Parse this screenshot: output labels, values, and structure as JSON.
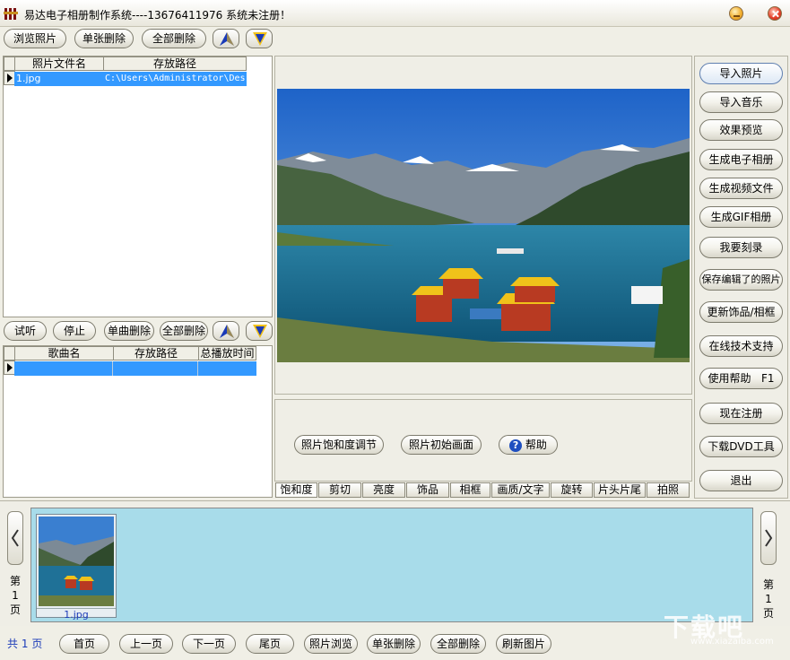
{
  "window": {
    "title": "易达电子相册制作系统----13676411976  系统未注册！"
  },
  "toolbar": {
    "browse": "浏览照片",
    "delete_one": "单张删除",
    "delete_all": "全部删除"
  },
  "photo_table": {
    "headers": [
      "照片文件名",
      "存放路径"
    ],
    "rows": [
      {
        "name": "1.jpg",
        "path": "C:\\Users\\Administrator\\Des"
      }
    ]
  },
  "music_toolbar": {
    "listen": "试听",
    "stop": "停止",
    "delete_one": "单曲删除",
    "delete_all": "全部删除"
  },
  "music_table": {
    "headers": [
      "歌曲名",
      "存放路径",
      "总播放时间"
    ]
  },
  "adjust": {
    "saturation_btn": "照片饱和度调节",
    "reset_btn": "照片初始画面",
    "help_btn": "帮助"
  },
  "tabs": [
    "饱和度",
    "剪切",
    "亮度",
    "饰品",
    "相框",
    "画质/文字",
    "旋转",
    "片头片尾",
    "拍照"
  ],
  "right_menu": [
    "导入照片",
    "导入音乐",
    "效果预览",
    "生成电子相册",
    "生成视频文件",
    "生成GIF相册",
    "我要刻录",
    "保存编辑了的照片",
    "更新饰品/相框",
    "在线技术支持",
    "使用帮助   F1",
    "现在注册",
    "下载DVD工具",
    "退出"
  ],
  "thumbnails": [
    {
      "label": "1.jpg"
    }
  ],
  "page_left": [
    "第",
    "1",
    "页"
  ],
  "page_right": [
    "第",
    "1",
    "页"
  ],
  "footer": {
    "total_prefix": "共",
    "total_num": "1",
    "total_suffix": "页",
    "first": "首页",
    "prev": "上一页",
    "next": "下一页",
    "last": "尾页",
    "browse": "照片浏览",
    "delete_one": "单张删除",
    "delete_all": "全部删除",
    "refresh": "刷新图片"
  },
  "watermark": {
    "main": "下载吧",
    "sub": "www.xiazaiba.com"
  },
  "colors": {
    "selection": "#3399ff",
    "strip": "#a8dcea",
    "accent_blue": "#1a3ab8",
    "accent_yellow": "#f2c21a"
  }
}
